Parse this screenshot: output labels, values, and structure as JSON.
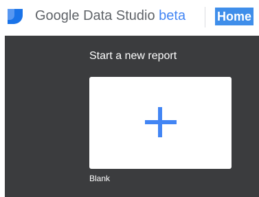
{
  "header": {
    "brand_google": "Google",
    "brand_product": "Data Studio",
    "brand_beta": "beta",
    "home_link": "Home",
    "logo_icon": "data-studio-logo-icon"
  },
  "gallery": {
    "title": "Start a new report",
    "templates": [
      {
        "label": "Blank",
        "icon": "plus-icon"
      }
    ]
  },
  "colors": {
    "logo_blue": "#1a73e8",
    "accent": "#4285f4",
    "gallery_bg": "#3b3c3e",
    "home_highlight": "#3f8eea"
  }
}
